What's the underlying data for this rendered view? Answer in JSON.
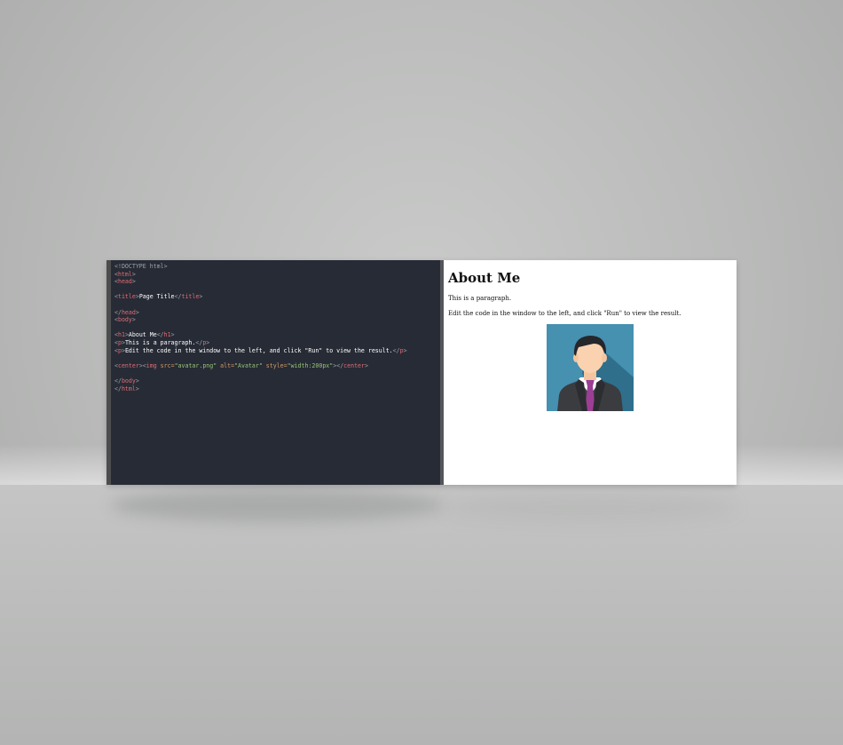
{
  "editor": {
    "lines": [
      [
        {
          "t": "<!DOCTYPE html>",
          "c": "gray"
        }
      ],
      [
        {
          "t": "<",
          "c": "gray"
        },
        {
          "t": "html",
          "c": "red"
        },
        {
          "t": ">",
          "c": "gray"
        }
      ],
      [
        {
          "t": "<",
          "c": "gray"
        },
        {
          "t": "head",
          "c": "red"
        },
        {
          "t": ">",
          "c": "gray"
        }
      ],
      [],
      [
        {
          "t": "<",
          "c": "gray"
        },
        {
          "t": "title",
          "c": "red"
        },
        {
          "t": ">",
          "c": "gray"
        },
        {
          "t": "Page Title",
          "c": "white"
        },
        {
          "t": "</",
          "c": "gray"
        },
        {
          "t": "title",
          "c": "red"
        },
        {
          "t": ">",
          "c": "gray"
        }
      ],
      [],
      [
        {
          "t": "</",
          "c": "gray"
        },
        {
          "t": "head",
          "c": "red"
        },
        {
          "t": ">",
          "c": "gray"
        }
      ],
      [
        {
          "t": "<",
          "c": "gray"
        },
        {
          "t": "body",
          "c": "red"
        },
        {
          "t": ">",
          "c": "gray"
        }
      ],
      [],
      [
        {
          "t": "<",
          "c": "gray"
        },
        {
          "t": "h1",
          "c": "red"
        },
        {
          "t": ">",
          "c": "gray"
        },
        {
          "t": "About Me",
          "c": "white"
        },
        {
          "t": "</",
          "c": "gray"
        },
        {
          "t": "h1",
          "c": "red"
        },
        {
          "t": ">",
          "c": "gray"
        }
      ],
      [
        {
          "t": "<",
          "c": "gray"
        },
        {
          "t": "p",
          "c": "red"
        },
        {
          "t": ">",
          "c": "gray"
        },
        {
          "t": "This is a paragraph.",
          "c": "white"
        },
        {
          "t": "</",
          "c": "gray"
        },
        {
          "t": "p",
          "c": "red"
        },
        {
          "t": ">",
          "c": "gray"
        }
      ],
      [
        {
          "t": "<",
          "c": "gray"
        },
        {
          "t": "p",
          "c": "red"
        },
        {
          "t": ">",
          "c": "gray"
        },
        {
          "t": "Edit the code in the window to the left, and click \"Run\" to view the result.",
          "c": "white"
        },
        {
          "t": "</",
          "c": "gray"
        },
        {
          "t": "p",
          "c": "red"
        },
        {
          "t": ">",
          "c": "gray"
        }
      ],
      [],
      [
        {
          "t": "<",
          "c": "gray"
        },
        {
          "t": "center",
          "c": "red"
        },
        {
          "t": ">",
          "c": "gray"
        },
        {
          "t": "<",
          "c": "gray"
        },
        {
          "t": "img",
          "c": "red"
        },
        {
          "t": " src=",
          "c": "orange"
        },
        {
          "t": "\"avatar.png\"",
          "c": "green"
        },
        {
          "t": " alt=",
          "c": "orange"
        },
        {
          "t": "\"Avatar\"",
          "c": "green"
        },
        {
          "t": " style=",
          "c": "orange"
        },
        {
          "t": "\"width:200px\"",
          "c": "green"
        },
        {
          "t": ">",
          "c": "gray"
        },
        {
          "t": "</",
          "c": "gray"
        },
        {
          "t": "center",
          "c": "red"
        },
        {
          "t": ">",
          "c": "gray"
        }
      ],
      [],
      [
        {
          "t": "</",
          "c": "gray"
        },
        {
          "t": "body",
          "c": "red"
        },
        {
          "t": ">",
          "c": "gray"
        }
      ],
      [
        {
          "t": "</",
          "c": "gray"
        },
        {
          "t": "html",
          "c": "red"
        },
        {
          "t": ">",
          "c": "gray"
        }
      ]
    ],
    "colors": {
      "background": "#272b35",
      "tag": "#e06c75",
      "punctuation": "#9ba1a9",
      "text": "#ffffff",
      "attribute": "#d19a66",
      "string": "#98c379"
    }
  },
  "preview": {
    "heading": "About Me",
    "paragraph_1": "This is a paragraph.",
    "paragraph_2": "Edit the code in the window to the left, and click \"Run\" to view the result.",
    "image_icon": "avatar-businessman-icon",
    "image_alt": "Avatar"
  }
}
